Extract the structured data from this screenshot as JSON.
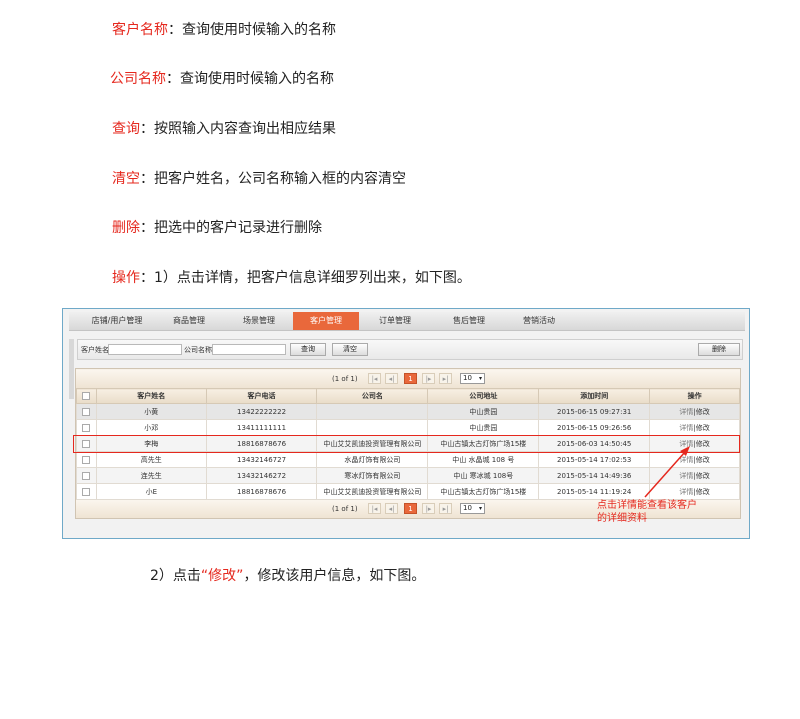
{
  "doc_lines": [
    {
      "term": "客户名称",
      "desc": "：查询使用时候输入的名称"
    },
    {
      "term": "公司名称",
      "desc": "：查询使用时候输入的名称"
    },
    {
      "term": "查询",
      "desc": "：按照输入内容查询出相应结果"
    },
    {
      "term": "清空",
      "desc": "：把客户姓名，公司名称输入框的内容清空"
    },
    {
      "term": "删除",
      "desc": "：把选中的客户记录进行删除"
    },
    {
      "term": "操作",
      "desc": "：1）点击详情，把客户信息详细罗列出来，如下图。"
    }
  ],
  "footer_line": {
    "pre": "2）点击",
    "term": "“修改”",
    "post": "，修改该用户信息，如下图。"
  },
  "nav": [
    "店铺/用户管理",
    "商品管理",
    "场景管理",
    "客户管理",
    "订单管理",
    "售后管理",
    "营销活动"
  ],
  "nav_active_index": 3,
  "search": {
    "customer_label": "客户姓名",
    "company_label": "公司名称",
    "query_button": "查询",
    "clear_button": "清空",
    "delete_button": "删除"
  },
  "pager": {
    "summary": "(1 of 1)",
    "first": "|◂",
    "prev": "◂|",
    "current": "1",
    "next": "|▸",
    "last": "▸|",
    "page_size": "10",
    "dropdown_arrow": "▾"
  },
  "table": {
    "columns": [
      "客户姓名",
      "客户电话",
      "公司名",
      "公司地址",
      "添加时间",
      "操作"
    ],
    "rows": [
      [
        "小黄",
        "13422222222",
        "",
        "中山贵园",
        "2015-06-15 09:27:31"
      ],
      [
        "小邓",
        "13411111111",
        "",
        "中山贵园",
        "2015-06-15 09:26:56"
      ],
      [
        "李梅",
        "18816878676",
        "中山艾艾凯迪投资管理有限公司",
        "中山古镇太古灯饰广场15楼",
        "2015-06-03 14:50:45"
      ],
      [
        "高先生",
        "13432146727",
        "水晶灯饰有限公司",
        "中山 水晶城 108 号",
        "2015-05-14 17:02:53"
      ],
      [
        "连先生",
        "13432146272",
        "寒冰灯饰有限公司",
        "中山 寒冰城 108号",
        "2015-05-14 14:49:36"
      ],
      [
        "小E",
        "18816878676",
        "中山艾艾凯迪投资管理有限公司",
        "中山古镇太古灯饰广场15楼",
        "2015-05-14 11:19:24"
      ]
    ],
    "op_detail": "详情",
    "op_sep": "|",
    "op_edit": "修改"
  },
  "annotation": [
    "点击详情能查看该客户",
    "的详细资料"
  ],
  "colors": {
    "accent": "#e5281e",
    "tab_active": "#e9683b",
    "frame": "#6fa9c8"
  }
}
